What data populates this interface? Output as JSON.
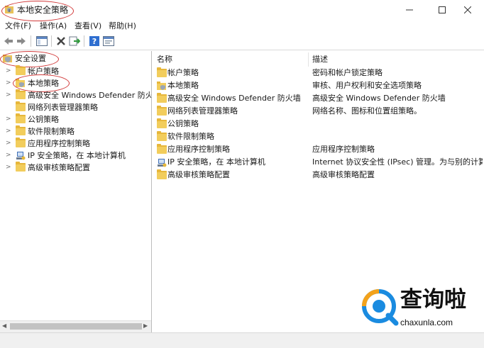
{
  "window": {
    "title": "本地安全策略"
  },
  "menu": [
    {
      "label": "文件(F)"
    },
    {
      "label": "操作(A)"
    },
    {
      "label": "查看(V)"
    },
    {
      "label": "帮助(H)"
    }
  ],
  "toolbar": {
    "icons": [
      "back-arrow-icon",
      "forward-arrow-icon",
      "show-hide-tree-icon",
      "delete-icon",
      "export-list-icon",
      "help-icon",
      "properties-icon"
    ]
  },
  "tree": {
    "root": "安全设置",
    "items": [
      {
        "label": "帐户策略"
      },
      {
        "label": "本地策略"
      },
      {
        "label": "高级安全 Windows Defender 防火墙"
      },
      {
        "label": "网络列表管理器策略"
      },
      {
        "label": "公钥策略"
      },
      {
        "label": "软件限制策略"
      },
      {
        "label": "应用程序控制策略"
      },
      {
        "label": "IP 安全策略，在 本地计算机"
      },
      {
        "label": "高级审核策略配置"
      }
    ]
  },
  "list": {
    "columns": {
      "name": "名称",
      "desc": "描述"
    },
    "rows": [
      {
        "name": "帐户策略",
        "desc": "密码和帐户锁定策略"
      },
      {
        "name": "本地策略",
        "desc": "审核、用户权利和安全选项策略"
      },
      {
        "name": "高级安全 Windows Defender 防火墙",
        "desc": "高级安全 Windows Defender 防火墙"
      },
      {
        "name": "网络列表管理器策略",
        "desc": "网络名称、图标和位置组策略。"
      },
      {
        "name": "公钥策略",
        "desc": ""
      },
      {
        "name": "软件限制策略",
        "desc": ""
      },
      {
        "name": "应用程序控制策略",
        "desc": "应用程序控制策略"
      },
      {
        "name": "IP 安全策略，在 本地计算机",
        "desc": "Internet 协议安全性 (IPsec) 管理。为与别的计算机通讯..."
      },
      {
        "name": "高级审核策略配置",
        "desc": "高级审核策略配置"
      }
    ]
  },
  "watermark": {
    "brand": "查询啦",
    "domain": "chaxunla.com"
  },
  "colors": {
    "accent_blue": "#1a8be0",
    "annotation_red": "#d23a3a",
    "folder": "#f2cd5c"
  }
}
